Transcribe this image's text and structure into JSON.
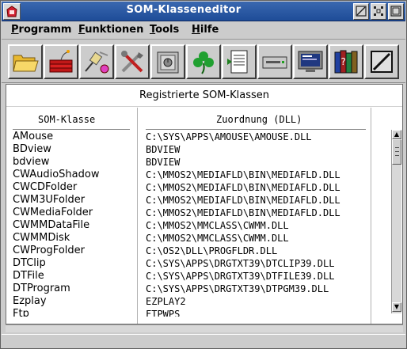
{
  "window": {
    "title": "SOM-Klasseneditor"
  },
  "menubar": {
    "items": [
      {
        "label_u": "P",
        "label_rest": "rogramm"
      },
      {
        "label_u": "F",
        "label_rest": "unktionen"
      },
      {
        "label_u": "T",
        "label_rest": "ools"
      },
      {
        "label_u": "H",
        "label_rest": "ilfe"
      }
    ]
  },
  "toolbar": {
    "icons": [
      "open-folder-icon",
      "dynamite-icon",
      "unplug-icon",
      "repair-tools-icon",
      "safe-icon",
      "shamrock-icon",
      "register-document-icon",
      "drive-icon",
      "monitor-icon",
      "books-help-icon",
      "shredder-icon"
    ]
  },
  "panel": {
    "title": "Registrierte SOM-Klassen",
    "col1_header": "SOM-Klasse",
    "col2_header": "Zuordnung (DLL)",
    "rows": [
      {
        "cls": "AMouse",
        "dll": "C:\\SYS\\APPS\\AMOUSE\\AMOUSE.DLL"
      },
      {
        "cls": "BDview",
        "dll": "BDVIEW"
      },
      {
        "cls": "bdview",
        "dll": "BDVIEW"
      },
      {
        "cls": "CWAudioShadow",
        "dll": "C:\\MMOS2\\MEDIAFLD\\BIN\\MEDIAFLD.DLL"
      },
      {
        "cls": "CWCDFolder",
        "dll": "C:\\MMOS2\\MEDIAFLD\\BIN\\MEDIAFLD.DLL"
      },
      {
        "cls": "CWM3UFolder",
        "dll": "C:\\MMOS2\\MEDIAFLD\\BIN\\MEDIAFLD.DLL"
      },
      {
        "cls": "CWMediaFolder",
        "dll": "C:\\MMOS2\\MEDIAFLD\\BIN\\MEDIAFLD.DLL"
      },
      {
        "cls": "CWMMDataFile",
        "dll": "C:\\MMOS2\\MMCLASS\\CWMM.DLL"
      },
      {
        "cls": "CWMMDisk",
        "dll": "C:\\MMOS2\\MMCLASS\\CWMM.DLL"
      },
      {
        "cls": "CWProgFolder",
        "dll": "C:\\OS2\\DLL\\PROGFLDR.DLL"
      },
      {
        "cls": "DTClip",
        "dll": "C:\\SYS\\APPS\\DRGTXT39\\DTCLIP39.DLL"
      },
      {
        "cls": "DTFile",
        "dll": "C:\\SYS\\APPS\\DRGTXT39\\DTFILE39.DLL"
      },
      {
        "cls": "DTProgram",
        "dll": "C:\\SYS\\APPS\\DRGTXT39\\DTPGM39.DLL"
      },
      {
        "cls": "Ezplay",
        "dll": "EZPLAY2"
      },
      {
        "cls": "Ftp",
        "dll": "FTPWPS"
      }
    ]
  }
}
